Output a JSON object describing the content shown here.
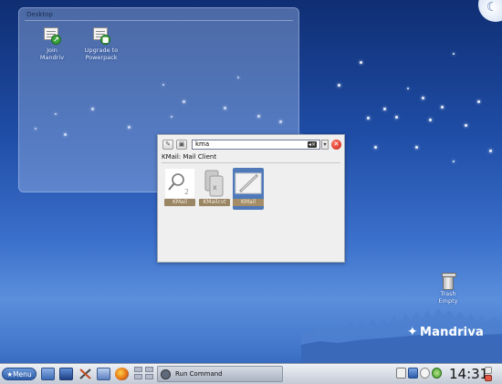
{
  "folder_view": {
    "title": "Desktop",
    "icons": [
      {
        "label": "Join\nMandriv",
        "icon": "document-with-green-arrow-icon"
      },
      {
        "label": "Upgrade to\nPowerpack",
        "icon": "document-with-green-lock-icon"
      }
    ]
  },
  "krunner": {
    "query": "kma",
    "status": "KMail: Mail Client",
    "results": [
      {
        "label": "KMail",
        "icon": "magnifier-icon"
      },
      {
        "label": "KMailcvt",
        "icon": "import-tool-icon"
      },
      {
        "label": "KMail",
        "icon": "kmail-envelope-icon",
        "selected": true
      }
    ]
  },
  "trash": {
    "label": "Trash\nEmpty"
  },
  "brand": {
    "name": "Mandriva"
  },
  "taskbar": {
    "menu_label": "Menu",
    "task_label": "Run Command",
    "clock": "14:31"
  },
  "colors": {
    "selection": "#4f79b8",
    "close": "#c81c10",
    "taskbar": "#d7dce5"
  }
}
